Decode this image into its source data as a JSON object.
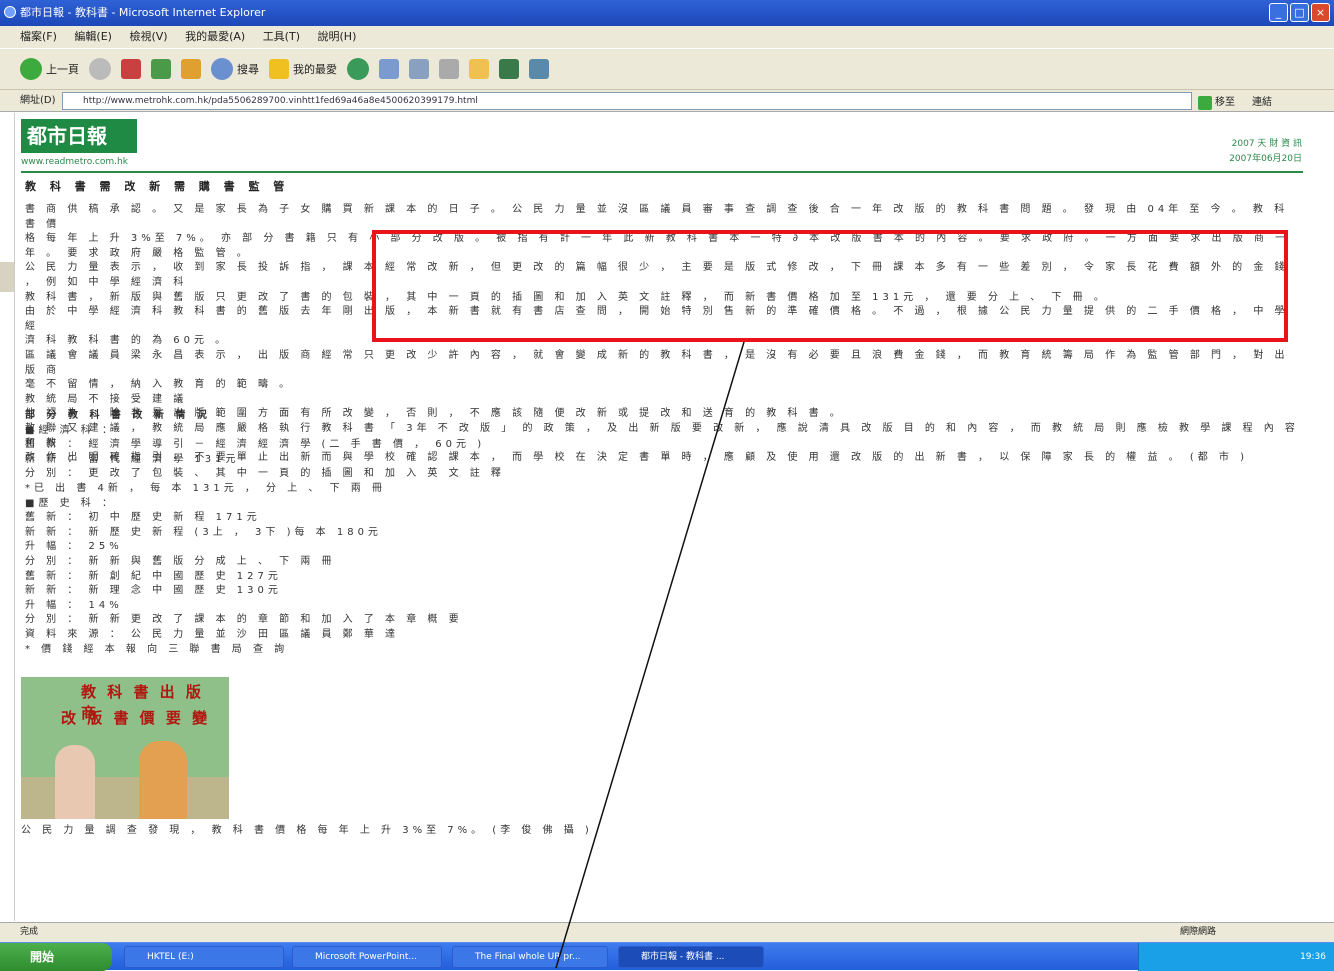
{
  "window": {
    "title": "都市日報 - 教科書 - Microsoft Internet Explorer",
    "controls": [
      "_",
      "□",
      "×"
    ]
  },
  "menu": {
    "items": [
      "檔案(F)",
      "編輯(E)",
      "檢視(V)",
      "我的最愛(A)",
      "工具(T)",
      "說明(H)"
    ]
  },
  "toolbar": {
    "back_label": "上一頁",
    "search_label": "搜尋",
    "favorites_label": "我的最愛"
  },
  "address": {
    "label": "網址(D)",
    "url": "http://www.metrohk.com.hk/pda5506289700.vinhtt1fed69a46a8e4500620399179.html",
    "go_label": "移至",
    "links_label": "連結"
  },
  "page": {
    "logo_text": "都市日報",
    "site_url": "www.readmetro.com.hk",
    "topright_line1": "2007 天 財 資 訊",
    "topright_line2": "2007年06月20日",
    "headline": "教 科 書 需 改 新 需 購 書 監 管",
    "article": [
      "書 商 供 稿 承 認 。 又 是 家 長 為 子 女 購 買 新 課 本 的 日 子 。 公 民 力 量 並 沒 區 議 員 審 事 查 調 查 後 合 一 年 改 版 的 教 科 書 問 題 。 發 現 由 04年 至 今 。 教 科 書 價",
      "格 每 年 上 升 3%至 7%。 亦 部 分 書 籍 只 有 小 部 分 改 版 。 被 指 有 計 一 年 此 新 教 科 書 本 一 特 ∂ 本 改 版 書 本 的 內 容 。 要 求 政 府 。 一 方 面 要 求 出 版 商 一",
      "年 。 要 求 政 府 嚴 格 監 管 。",
      "公 民 力 量 表 示 ， 收 到 家 長 投 訴 指 ， 課 本 經 常 改 新 ， 但 更 改 的 篇 幅 很 少 ， 主 要 是 版 式 修 改 ， 下 冊 課 本 多 有 一 些 差 別 ， 令 家 長 花 費 額 外 的 金 錢 ， 例 如 中 學 經 濟 科",
      "教 科 書 ， 新 版 與 舊 版 只 更 改 了 書 的 包 裝 ， 其 中 一 頁 的 插 圖 和 加 入 英 文 註 釋 ， 而 新 書 價 格 加 至 131元 ， 還 要 分 上 、 下 冊 。",
      "由 於 中 學 經 濟 科 教 科 書 的 舊 版 去 年 剛 出 版 ， 本 新 書 就 有 書 店 查 問 ， 開 始 特 別 售 新 的 準 確 價 格 。 不 過 ， 根 據 公 民 力 量 提 供 的 二 手 價 格 ， 中 學 經",
      "濟 科 教 科 書 的 為 60元 。",
      "區 議 會 議 員 梁 永 昌 表 示 ， 出 版 商 經 常 只 更 改 少 許 內 容 ， 就 會 變 成 新 的 教 科 書 ， 是 沒 有 必 要 且 浪 費 金 錢 ， 而 教 育 統 籌 局 作 為 監 管 部 門 ， 對 出 版 商",
      "毫 不 留 情 ， 納 入 教 育 的 範 疇 。",
      "教 統 局 不 接 受 建 議",
      "他 認 為 ， 除 非 是 出 版 範 圍 方 面 有 所 改 變 ， 否 則 ， 不 應 該 隨 便 改 新 或 提 改 和 送 育 的 教 科 書 。",
      "教 聯 又 建 議 ， 教 統 局 應 嚴 格 執 行 教 科 書 「 3年 不 改 版 」 的 政 策 ， 及 出 新 版 要 改 新 ， 應 說 清 具 改 版 目 的 和 內 容 ， 而 教 統 局 則 應 檢 教 學 課 程 內 容 和 教",
      "改 作 出 明 確 指 引 ， 不 要 單 止 出 新 而 與 學 校 確 認 課 本 ， 而 學 校 在 決 定 書 單 時 ， 應 顧 及 使 用 還 改 版 的 出 新 書 ， 以 保 障 家 長 的 權 益 。 (都 市 )"
    ],
    "section2": {
      "heading": "部 分 教 科 書 改 新 情 況",
      "lines": [
        "■經 濟 科 ：",
        "舊 新 ： 經 濟 學 導 引 － 經 濟 經 濟 學 (二 手 書 價 ， 60元 )",
        "新 新 ： 當 代 經 濟 學 131元",
        "分 別 ： 更 改 了 包 裝 、 其 中 一 頁 的 插 圖 和 加 入 英 文 註 釋",
        "*已 出 書 4新 ， 每 本 131元 ， 分 上 、 下 兩 冊",
        "■歷 史 科 ：",
        "舊 新 ： 初 中 歷 史 新 程 171元",
        "新 新 ： 新 歷 史 新 程 (3上 ， 3下 )每 本 180元",
        "升 幅 ： 25%",
        "分 別 ： 新 新 與 舊 版 分 成 上 、 下 兩 冊",
        "舊 新 ： 新 創 紀 中 國 歷 史 127元",
        "新 新 ： 新 理 念 中 國 歷 史 130元",
        "升 幅 ： 14%",
        "分 別 ： 新 新 更 改 了 課 本 的 章 節 和 加 入 了 本 章 概 要",
        "資 料 來 源 ： 公 民 力 量 並 沙 田 區 議 員 鄭 華 達",
        "* 價 錢 經 本 報 向 三 聯 書 局 查 詢"
      ]
    },
    "photo_sign_text": "教 科 書 出 版 商",
    "photo_sign_text2": "改 版 書 價 要 變",
    "caption": "公 民 力 量 調 查 發 現 ， 教 科 書 價 格 每 年 上 升 3%至 7%。 (李 俊 佛 攝 )"
  },
  "status": {
    "left": "完成",
    "zone": "網際網路"
  },
  "taskbar": {
    "start": "開始",
    "tasks": [
      "HKTEL (E:)",
      "Microsoft PowerPoint...",
      "The Final whole UR pr...",
      "都市日報 - 教科書 ..."
    ],
    "clock": "19:36"
  },
  "colors": {
    "highlight_box": "#e8141a",
    "logo_green": "#1f8a44"
  }
}
